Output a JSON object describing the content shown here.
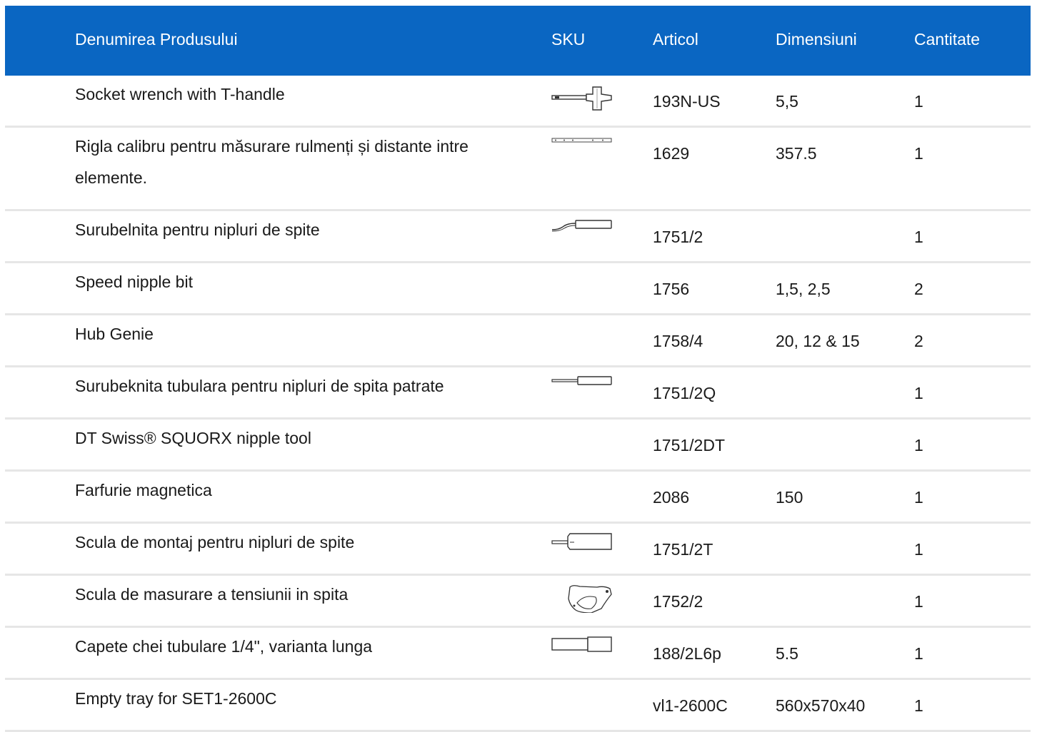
{
  "header": {
    "name": "Denumirea Produsului",
    "sku": "SKU",
    "articol": "Articol",
    "dimensiuni": "Dimensiuni",
    "cantitate": "Cantitate"
  },
  "colors": {
    "header_bg": "#0a66c2",
    "header_text": "#ffffff",
    "row_divider": "#e6e6e6"
  },
  "rows": [
    {
      "name": "Socket wrench with T-handle",
      "sku_icon": "t-handle-wrench-icon",
      "articol": "193N-US",
      "dimensiuni": "5,5",
      "cantitate": "1"
    },
    {
      "name": "Rigla calibru pentru măsurare rulmenți și distante intre elemente.",
      "sku_icon": "measuring-ruler-icon",
      "articol": "1629",
      "dimensiuni": "357.5",
      "cantitate": "1"
    },
    {
      "name": "Surubelnita pentru nipluri de spite",
      "sku_icon": "bent-screwdriver-icon",
      "articol": "1751/2",
      "dimensiuni": "",
      "cantitate": "1"
    },
    {
      "name": "Speed nipple bit",
      "sku_icon": "",
      "articol": "1756",
      "dimensiuni": "1,5, 2,5",
      "cantitate": "2"
    },
    {
      "name": "Hub Genie",
      "sku_icon": "",
      "articol": "1758/4",
      "dimensiuni": "20, 12 & 15",
      "cantitate": "2"
    },
    {
      "name": "Surubeknita tubulara pentru nipluri de spita patrate",
      "sku_icon": "screwdriver-icon",
      "articol": "1751/2Q",
      "dimensiuni": "",
      "cantitate": "1"
    },
    {
      "name": "DT Swiss® SQUORX nipple tool",
      "sku_icon": "",
      "articol": "1751/2DT",
      "dimensiuni": "",
      "cantitate": "1"
    },
    {
      "name": "Farfurie magnetica",
      "sku_icon": "",
      "articol": "2086",
      "dimensiuni": "150",
      "cantitate": "1"
    },
    {
      "name": "Scula de montaj pentru nipluri de spite",
      "sku_icon": "nipple-driver-icon",
      "articol": "1751/2T",
      "dimensiuni": "",
      "cantitate": "1"
    },
    {
      "name": "Scula de masurare a tensiunii in spita",
      "sku_icon": "tension-meter-icon",
      "articol": "1752/2",
      "dimensiuni": "",
      "cantitate": "1"
    },
    {
      "name": "Capete chei tubulare 1/4\", varianta lunga",
      "sku_icon": "socket-bit-icon",
      "articol": "188/2L6p",
      "dimensiuni": "5.5",
      "cantitate": "1"
    },
    {
      "name": "Empty tray for SET1-2600C",
      "sku_icon": "",
      "articol": "vl1-2600C",
      "dimensiuni": "560x570x40",
      "cantitate": "1"
    }
  ]
}
